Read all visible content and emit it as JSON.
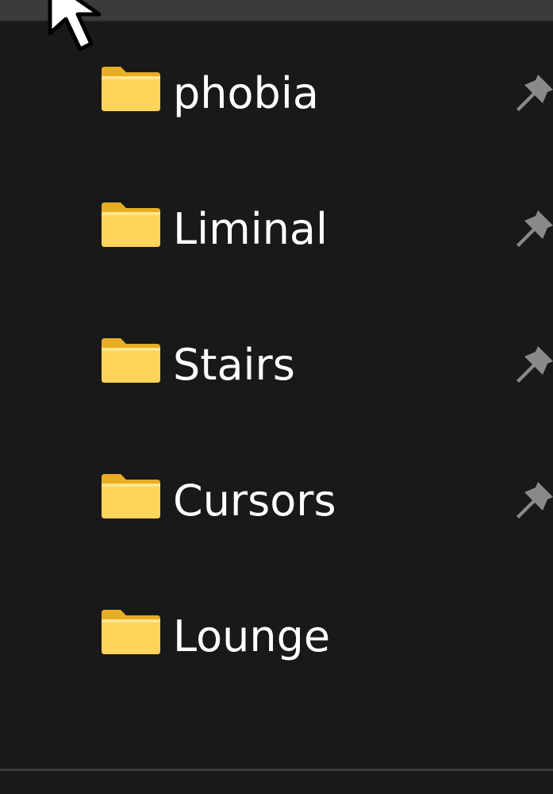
{
  "quick_access": {
    "items": [
      {
        "label": "phobia",
        "icon": "folder-icon",
        "pinned": true,
        "pin_icon": "pin-icon"
      },
      {
        "label": "Liminal",
        "icon": "folder-icon",
        "pinned": true,
        "pin_icon": "pin-icon"
      },
      {
        "label": "Stairs",
        "icon": "folder-icon",
        "pinned": true,
        "pin_icon": "pin-icon"
      },
      {
        "label": "Cursors",
        "icon": "folder-icon",
        "pinned": true,
        "pin_icon": "pin-icon"
      },
      {
        "label": "Lounge",
        "icon": "folder-icon",
        "pinned": false
      }
    ]
  },
  "colors": {
    "background": "#191919",
    "text": "#ffffff",
    "folder_front": "#ffd45a",
    "folder_back": "#e8ad23",
    "pin": "#8a8a8a"
  },
  "cursor_icon": "mouse-pointer-icon"
}
